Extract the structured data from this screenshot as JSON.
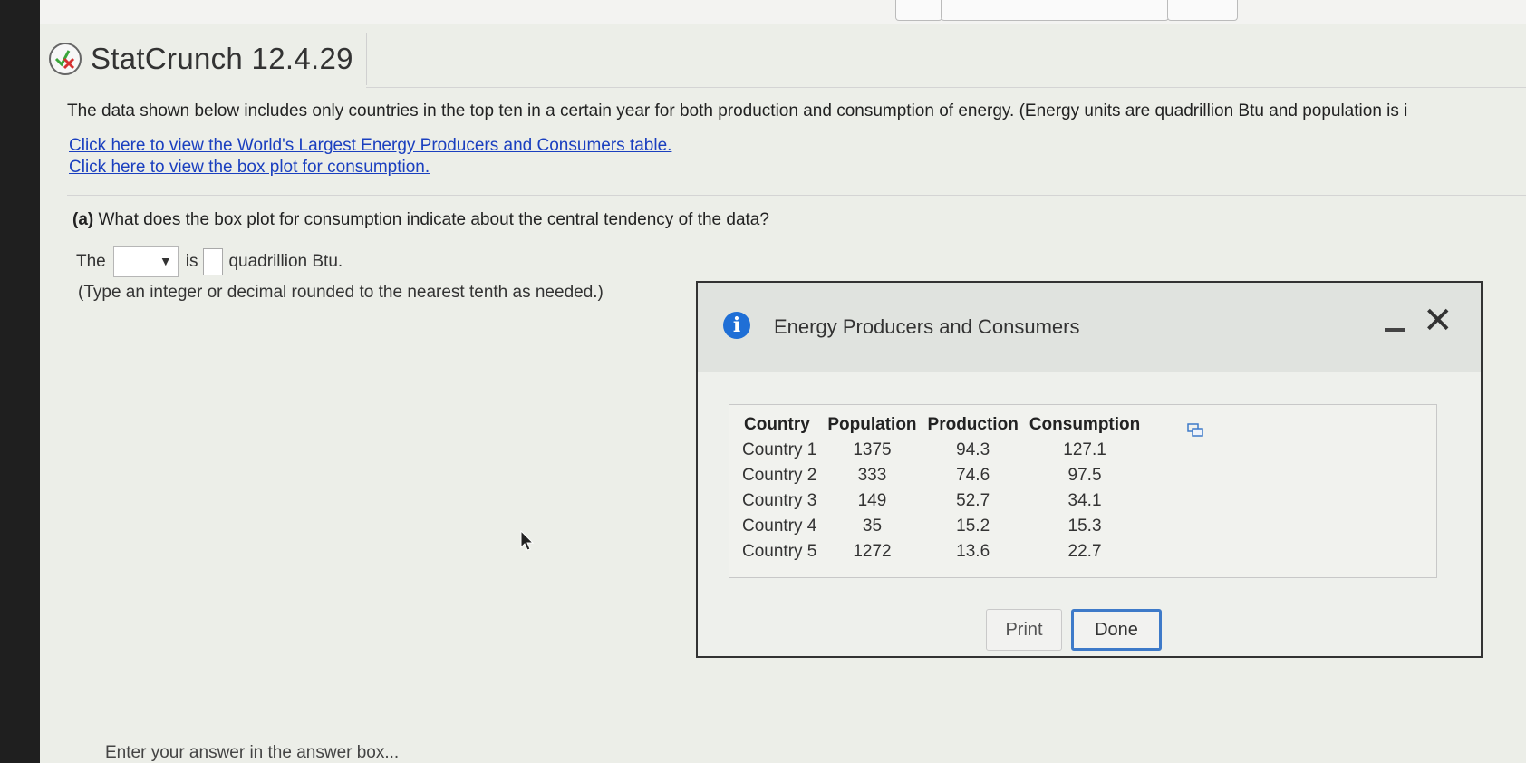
{
  "header": {
    "title": "StatCrunch 12.4.29"
  },
  "question": {
    "intro": "The data shown below includes only countries in the top ten in a certain year for both production and consumption of energy. (Energy units are quadrillion Btu and population is i",
    "links": [
      "Click here to view the World's Largest Energy Producers and Consumers table.",
      "Click here to view the box plot for consumption."
    ],
    "part_label": "(a)",
    "part_text": "What does the box plot for consumption indicate about the central tendency of the data?",
    "answer_prefix": "The",
    "answer_mid": "is",
    "answer_suffix": "quadrillion Btu.",
    "hint": "(Type an integer or decimal rounded to the nearest tenth as needed.)",
    "footer": "Enter your answer in the answer box..."
  },
  "dialog": {
    "title": "Energy Producers and Consumers",
    "columns": [
      "Country",
      "Population",
      "Production",
      "Consumption"
    ],
    "rows": [
      [
        "Country 1",
        "1375",
        "94.3",
        "127.1"
      ],
      [
        "Country 2",
        "333",
        "74.6",
        "97.5"
      ],
      [
        "Country 3",
        "149",
        "52.7",
        "34.1"
      ],
      [
        "Country 4",
        "35",
        "15.2",
        "15.3"
      ],
      [
        "Country 5",
        "1272",
        "13.6",
        "22.7"
      ]
    ],
    "print_label": "Print",
    "done_label": "Done"
  },
  "colors": {
    "link": "#1a3fbf",
    "info_icon": "#1f6fd6",
    "done_border": "#3e7ac9",
    "status_check": "#3aa63a",
    "status_x": "#d63030"
  },
  "icons": [
    "partial-credit-icon",
    "dropdown-arrow-icon",
    "info-icon",
    "minimize-icon",
    "close-icon",
    "copy-table-icon",
    "mouse-cursor-icon"
  ]
}
